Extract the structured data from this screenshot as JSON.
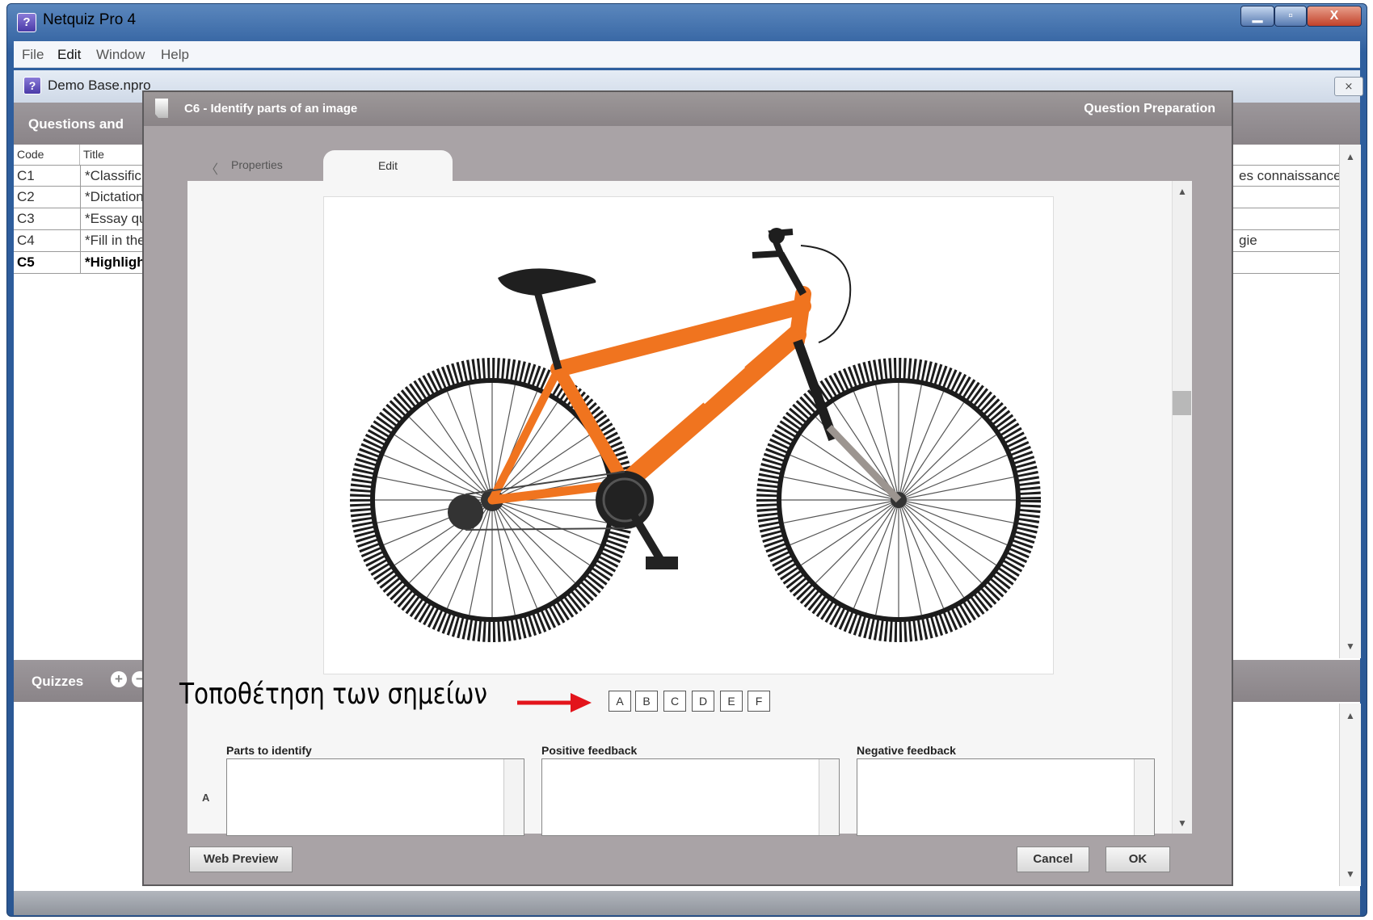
{
  "window": {
    "title": "Netquiz Pro 4",
    "controls": {
      "minimize": "▁",
      "maximize": "▫",
      "close": "X"
    }
  },
  "menu": [
    "File",
    "Edit",
    "Window",
    "Help"
  ],
  "document": {
    "title": "Demo Base.npro",
    "close_glyph": "⨯"
  },
  "questions_panel": {
    "title": "Questions and",
    "columns": {
      "code": "Code",
      "title": "Title"
    },
    "rows": [
      {
        "code": "C1",
        "title": "*Classific",
        "right": "es connaissance"
      },
      {
        "code": "C2",
        "title": "*Dictation",
        "right": ""
      },
      {
        "code": "C3",
        "title": "*Essay qu",
        "right": ""
      },
      {
        "code": "C4",
        "title": "*Fill in the",
        "right": "gie"
      },
      {
        "code": "C5",
        "title": "*Highlight",
        "right": ""
      }
    ]
  },
  "quizzes_panel": {
    "title": "Quizzes",
    "add": "+",
    "remove": "−"
  },
  "dialog": {
    "title": "C6 - Identify parts of an image",
    "context": "Question Preparation",
    "tabs": {
      "back": "〈",
      "properties": "Properties",
      "edit": "Edit"
    },
    "annotation": "Τοποθέτηση των σημείων",
    "letters": [
      "A",
      "B",
      "C",
      "D",
      "E",
      "F"
    ],
    "fields": {
      "parts": "Parts to identify",
      "positive": "Positive feedback",
      "negative": "Negative feedback"
    },
    "row_letter": "A",
    "buttons": {
      "preview": "Web Preview",
      "cancel": "Cancel",
      "ok": "OK"
    }
  },
  "colors": {
    "frame_orange": "#f0741f",
    "annotation_arrow": "#e3141b"
  }
}
